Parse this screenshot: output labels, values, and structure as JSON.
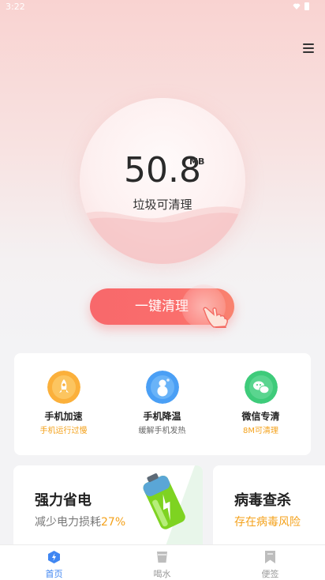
{
  "status_bar": {
    "time": "3:22"
  },
  "junk": {
    "value": "50.8",
    "unit": "MB",
    "label": "垃圾可清理"
  },
  "clean_button": {
    "label": "一键清理"
  },
  "tools": [
    {
      "name": "手机加速",
      "desc": "手机运行过慢",
      "icon": "rocket-icon",
      "color": "#fbb03b",
      "desc_color": "#f4a21c"
    },
    {
      "name": "手机降温",
      "desc": "缓解手机发热",
      "icon": "snowman-icon",
      "color": "#4a9ff5",
      "desc_color": "#666666"
    },
    {
      "name": "微信专清",
      "desc": "8M可清理",
      "icon": "wechat-icon",
      "color": "#3ecb7a",
      "desc_color": "#f4a21c"
    }
  ],
  "cards": {
    "power": {
      "title": "强力省电",
      "desc_prefix": "减少电力损耗",
      "desc_highlight": "27%",
      "icon": "battery-icon"
    },
    "virus": {
      "title": "病毒查杀",
      "desc": "存在病毒风险"
    }
  },
  "tabs": [
    {
      "label": "首页",
      "icon": "home-bolt-icon",
      "active": true
    },
    {
      "label": "喝水",
      "icon": "cup-icon",
      "active": false
    },
    {
      "label": "便签",
      "icon": "bookmark-icon",
      "active": false
    }
  ],
  "colors": {
    "accent_red": "#f8686b",
    "tab_active": "#3f86f2",
    "highlight_orange": "#f4a21c"
  }
}
